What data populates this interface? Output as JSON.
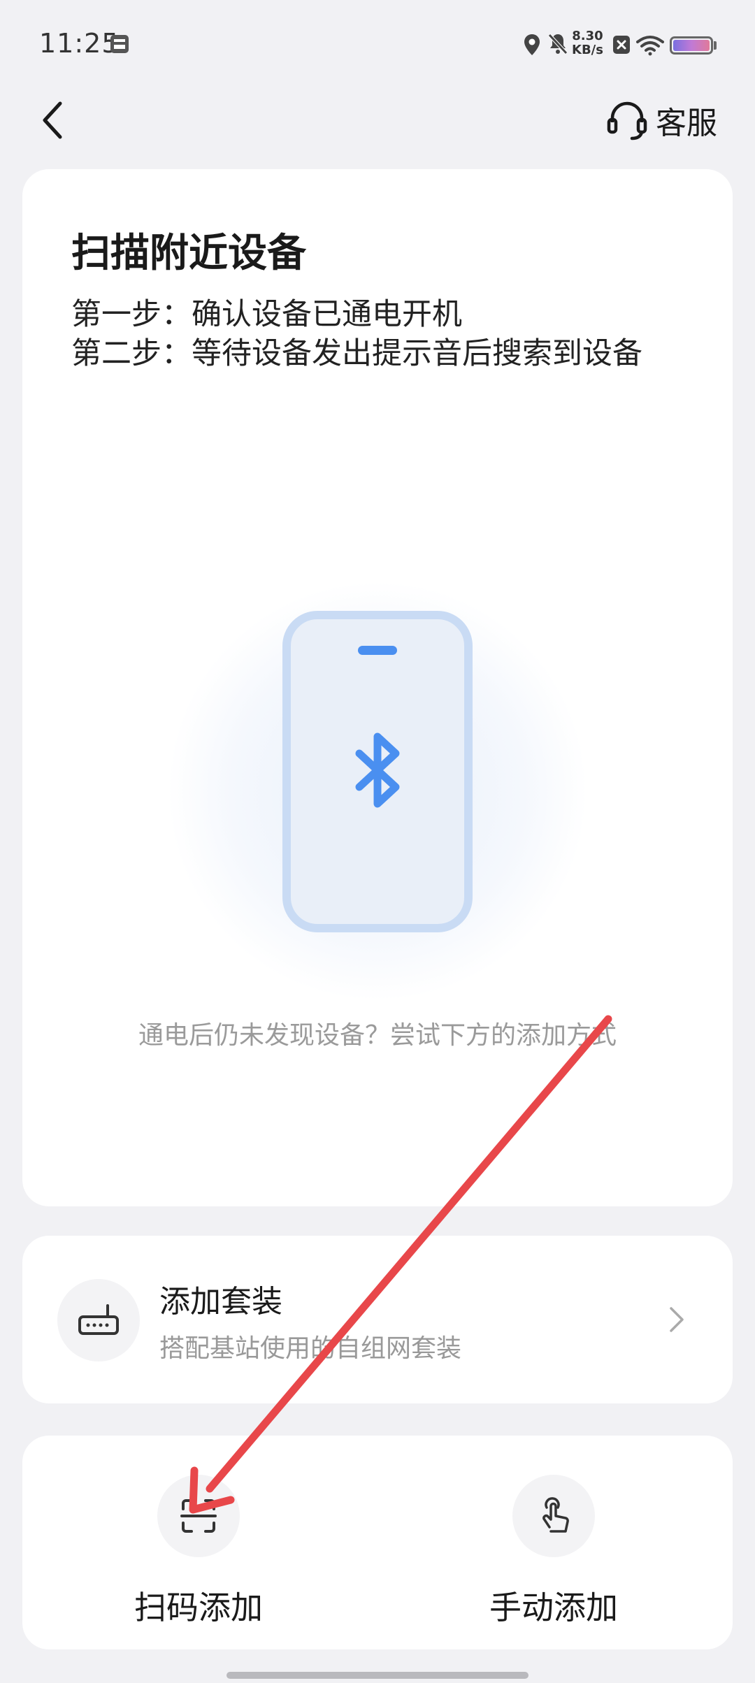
{
  "status_bar": {
    "time": "11:25",
    "net_speed_value": "8.30",
    "net_speed_unit": "KB/s",
    "icons": [
      "gallery-icon",
      "location-icon",
      "mute-icon",
      "close-box-icon",
      "wifi-icon",
      "battery-icon"
    ]
  },
  "header": {
    "back_icon": "chevron-left-icon",
    "service_label": "客服",
    "service_icon": "headset-icon"
  },
  "scan_card": {
    "title": "扫描附近设备",
    "step1": "第一步：确认设备已通电开机",
    "step2": "第二步：等待设备发出提示音后搜索到设备",
    "illustration_icon": "bluetooth-phone-icon",
    "hint": "通电后仍未发现设备？尝试下方的添加方式"
  },
  "suite_card": {
    "title": "添加套装",
    "subtitle": "搭配基站使用的自组网套装",
    "icon": "router-icon"
  },
  "add_options": {
    "scan_label": "扫码添加",
    "manual_label": "手动添加"
  },
  "colors": {
    "accent_blue": "#4a8ff0",
    "annotation_red": "#e8474a",
    "background": "#f1f1f4"
  }
}
